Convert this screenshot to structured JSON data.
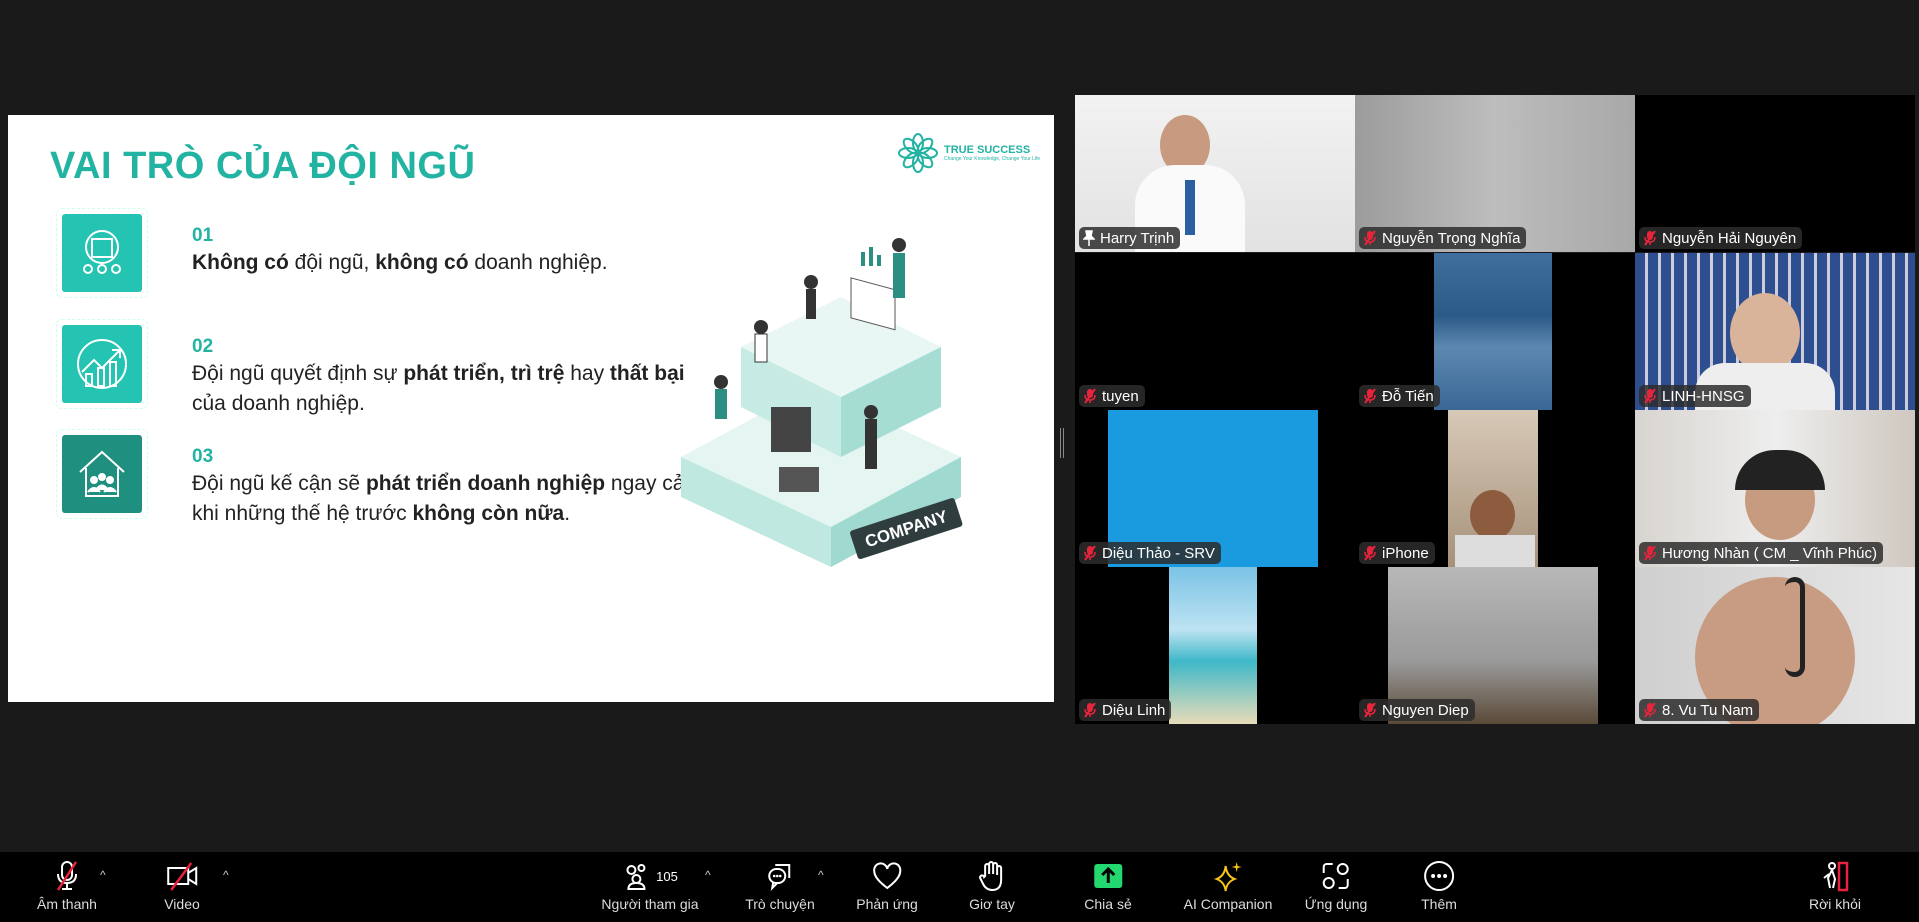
{
  "slide": {
    "title": "VAI TRÒ CỦA ĐỘI NGŨ",
    "logo": {
      "name": "TRUE SUCCESS",
      "tagline": "Change Your Knowledge, Change Your Life"
    },
    "items": [
      {
        "num": "01",
        "parts": [
          {
            "b": true,
            "t": "Không có"
          },
          {
            "b": false,
            "t": " đội ngũ, "
          },
          {
            "b": true,
            "t": "không có"
          },
          {
            "b": false,
            "t": " doanh nghiệp."
          }
        ]
      },
      {
        "num": "02",
        "parts": [
          {
            "b": false,
            "t": "Đội ngũ quyết định sự "
          },
          {
            "b": true,
            "t": "phát triển, trì trệ"
          },
          {
            "b": false,
            "t": " hay "
          },
          {
            "b": true,
            "t": "thất bại"
          },
          {
            "b": false,
            "t": " của doanh nghiệp."
          }
        ]
      },
      {
        "num": "03",
        "parts": [
          {
            "b": false,
            "t": "Đội ngũ kế cận sẽ "
          },
          {
            "b": true,
            "t": "phát triển doanh nghiệp"
          },
          {
            "b": false,
            "t": " ngay cả khi những thế hệ trước "
          },
          {
            "b": true,
            "t": "không còn nữa"
          },
          {
            "b": false,
            "t": "."
          }
        ]
      }
    ],
    "illustration_sign": "COMPANY",
    "accent": "#22b3a3"
  },
  "participants": [
    {
      "name": "Harry Trịnh",
      "icon": "pin-icon",
      "active": true
    },
    {
      "name": "Nguyễn Trọng Nghĩa",
      "icon": "mic-muted-icon"
    },
    {
      "name": "Nguyễn Hải Nguyên",
      "icon": "mic-muted-icon"
    },
    {
      "name": "tuyen",
      "icon": "mic-muted-icon"
    },
    {
      "name": "Đỗ Tiến",
      "icon": "mic-muted-icon"
    },
    {
      "name": "LINH-HNSG",
      "icon": "mic-muted-icon"
    },
    {
      "name": "Diệu Thảo - SRV",
      "icon": "mic-muted-icon"
    },
    {
      "name": "iPhone",
      "icon": "mic-muted-icon"
    },
    {
      "name": "Hương Nhàn ( CM _ Vĩnh Phúc)",
      "icon": "mic-muted-icon"
    },
    {
      "name": "Diệu Linh",
      "icon": "mic-muted-icon"
    },
    {
      "name": "Nguyen Diep",
      "icon": "mic-muted-icon"
    },
    {
      "name": "8. Vu Tu Nam",
      "icon": "mic-muted-icon"
    }
  ],
  "toolbar": {
    "audio": "Âm thanh",
    "video": "Video",
    "participants": "Người tham gia",
    "participants_count": "105",
    "chat": "Trò chuyện",
    "reactions": "Phản ứng",
    "raise_hand": "Giơ tay",
    "share": "Chia sẻ",
    "ai": "AI Companion",
    "apps": "Ứng dụng",
    "more": "Thêm",
    "leave": "Rời khỏi",
    "share_color": "#23d96f",
    "leave_color": "#e8243c",
    "muted_color": "#e8243c"
  }
}
